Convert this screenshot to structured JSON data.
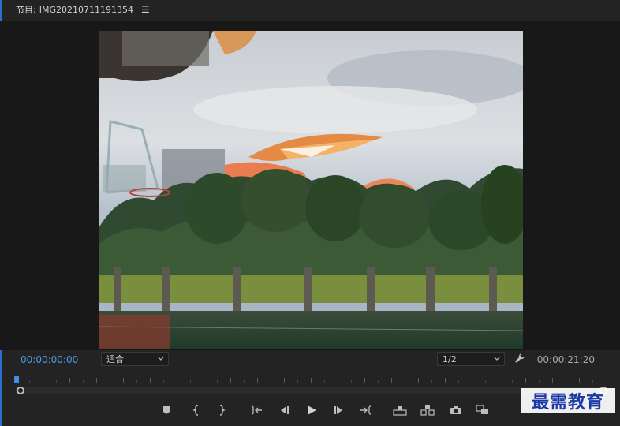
{
  "header": {
    "prefix": "节目:",
    "title": "IMG20210711191354",
    "menu_icon": "hamburger-menu-icon"
  },
  "monitor": {
    "frame_content": "video-frame"
  },
  "controls": {
    "current_timecode": "00:00:00:00",
    "zoom_select": "适合",
    "resolution_select": "1/2",
    "settings_icon": "wrench-icon",
    "duration_timecode": "00:00:21:20"
  },
  "timeline": {
    "playhead_position": 0
  },
  "transport": {
    "buttons": [
      "add-marker-icon",
      "mark-in-icon",
      "mark-out-icon",
      "go-to-in-icon",
      "step-back-icon",
      "play-icon",
      "step-forward-icon",
      "go-to-out-icon",
      "lift-icon",
      "extract-icon",
      "export-frame-icon",
      "compare-view-icon"
    ],
    "add_button": "+"
  },
  "watermark": {
    "text": "最需教育"
  },
  "colors": {
    "accent": "#3d8fe8",
    "background": "#232323",
    "monitor_bg": "#181818"
  }
}
